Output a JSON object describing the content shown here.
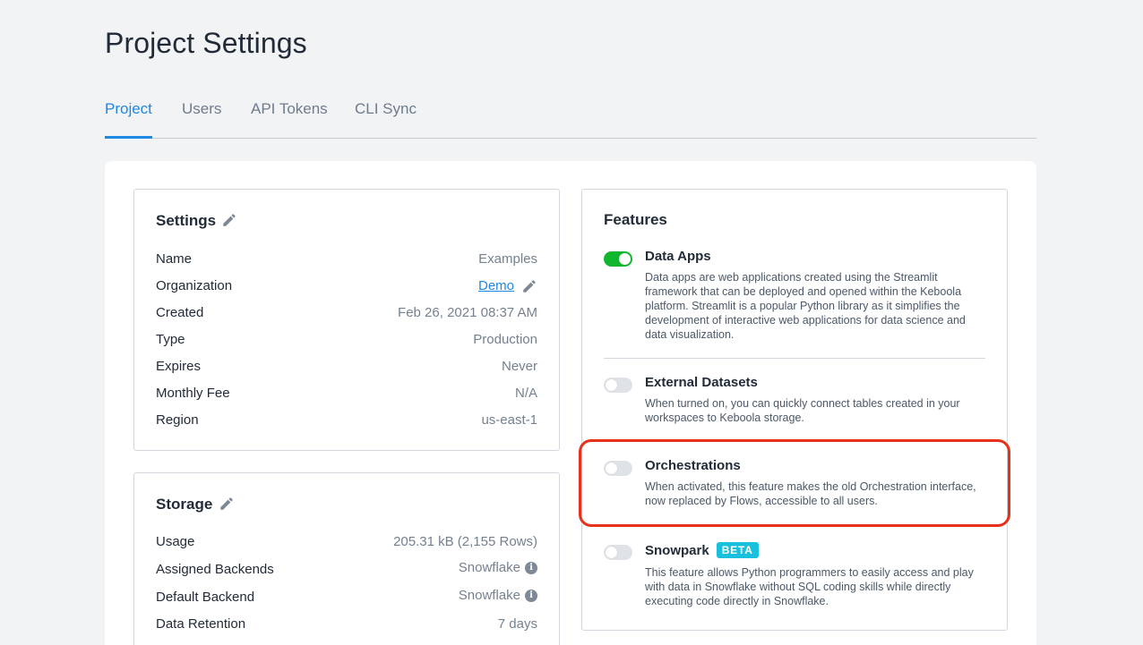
{
  "page": {
    "title": "Project Settings"
  },
  "tabs": [
    {
      "label": "Project",
      "active": true
    },
    {
      "label": "Users",
      "active": false
    },
    {
      "label": "API Tokens",
      "active": false
    },
    {
      "label": "CLI Sync",
      "active": false
    }
  ],
  "settings": {
    "title": "Settings",
    "icon": "pencil-icon",
    "rows": [
      {
        "label": "Name",
        "value": "Examples"
      },
      {
        "label": "Organization",
        "value": "Demo",
        "link": true,
        "icon": "pencil-icon"
      },
      {
        "label": "Created",
        "value": "Feb 26, 2021 08:37 AM"
      },
      {
        "label": "Type",
        "value": "Production"
      },
      {
        "label": "Expires",
        "value": "Never"
      },
      {
        "label": "Monthly Fee",
        "value": "N/A"
      },
      {
        "label": "Region",
        "value": "us-east-1"
      }
    ]
  },
  "storage": {
    "title": "Storage",
    "icon": "pencil-icon",
    "rows": [
      {
        "label": "Usage",
        "value": "205.31 kB (2,155 Rows)"
      },
      {
        "label": "Assigned Backends",
        "value": "Snowflake",
        "icon": "info-icon"
      },
      {
        "label": "Default Backend",
        "value": "Snowflake",
        "icon": "info-icon"
      },
      {
        "label": "Data Retention",
        "value": "7 days"
      }
    ]
  },
  "features": {
    "title": "Features",
    "items": [
      {
        "name": "Data Apps",
        "enabled": true,
        "description": "Data apps are web applications created using the Streamlit framework that can be deployed and opened within the Keboola platform. Streamlit is a popular Python library as it simplifies the development of interactive web applications for data science and data visualization."
      },
      {
        "name": "External Datasets",
        "enabled": false,
        "description": "When turned on, you can quickly connect tables created in your workspaces to Keboola storage."
      },
      {
        "name": "Orchestrations",
        "enabled": false,
        "description": "When activated, this feature makes the old Orchestration interface, now replaced by Flows, accessible to all users."
      },
      {
        "name": "Snowpark",
        "badge": "BETA",
        "enabled": false,
        "description": "This feature allows Python programmers to easily access and play with data in Snowflake without SQL coding skills while directly executing code directly in Snowflake."
      }
    ]
  },
  "colors": {
    "accent": "#1e88e5",
    "toggle_on": "#11b62f",
    "badge": "#17c0dd",
    "highlight": "#e8311a"
  }
}
